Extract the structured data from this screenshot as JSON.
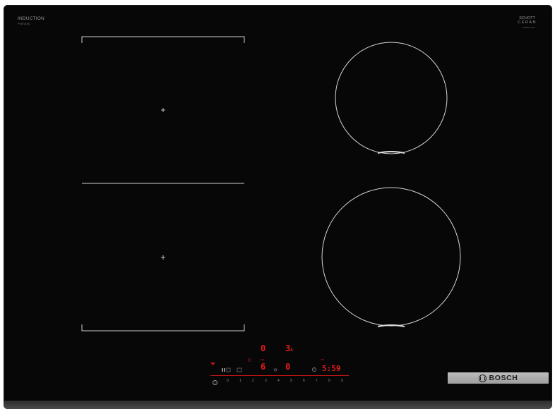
{
  "brand": {
    "induction_label": "INDUCTION",
    "model_label": "PVS731HC",
    "schott_line1": "SCHOTT",
    "schott_line2": "CERAN",
    "schott_sub": "MADE IN EU",
    "bosch_label": "BOSCH"
  },
  "display": {
    "zone_front_left_level": "6",
    "zone_rear_left_level": "0",
    "zone_rear_right_level": "3",
    "zone_rear_right_suffix": "A",
    "zone_front_right_level": "0",
    "timer_readout": "5:59"
  },
  "power_scale": [
    "0",
    "1",
    "2",
    "3",
    "4",
    "5",
    "6",
    "7",
    "8",
    "9"
  ],
  "icons": {
    "info": "info-icon",
    "wifi": "wifi-icon",
    "timer": "clock-icon",
    "bosch": "bosch-logo-icon"
  },
  "colors": {
    "glass": "#070707",
    "display_red": "#e21b1b",
    "print_grey": "#8a8a8a"
  }
}
